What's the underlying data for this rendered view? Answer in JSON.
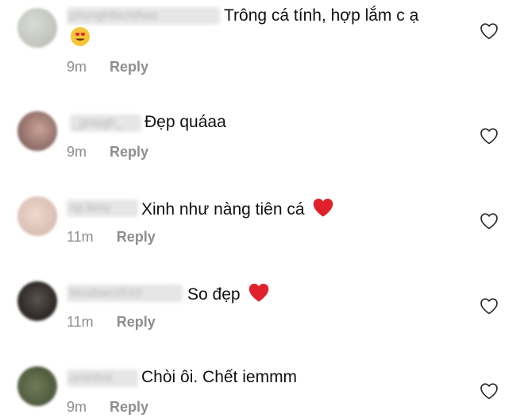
{
  "comments": [
    {
      "username": "phunghibichthao",
      "text": "Trông cá tính, hợp lắm c ạ",
      "emoji": "heart-eyes-emoji",
      "time": "9m",
      "reply": "Reply"
    },
    {
      "username": "_gnaigh_",
      "text": "Đẹp quáaa",
      "emoji": "",
      "time": "9m",
      "reply": "Reply"
    },
    {
      "username": "np.lieny",
      "text": "Xinh như nàng tiên cá",
      "emoji": "red-heart-emoji",
      "time": "11m",
      "reply": "Reply"
    },
    {
      "username": "lieudoan2510",
      "text": "So đẹp",
      "emoji": "red-heart-emoji",
      "time": "11m",
      "reply": "Reply"
    },
    {
      "username": "uminhnt",
      "text": "Chòi ôi. Chết iemmm",
      "emoji": "",
      "time": "9m",
      "reply": "Reply"
    }
  ],
  "colors": {
    "text": "#111111",
    "meta": "#8e8e8e",
    "heart": "#e0202b",
    "like_icon": "#262626"
  },
  "icons": {
    "like": "heart-outline-icon"
  }
}
